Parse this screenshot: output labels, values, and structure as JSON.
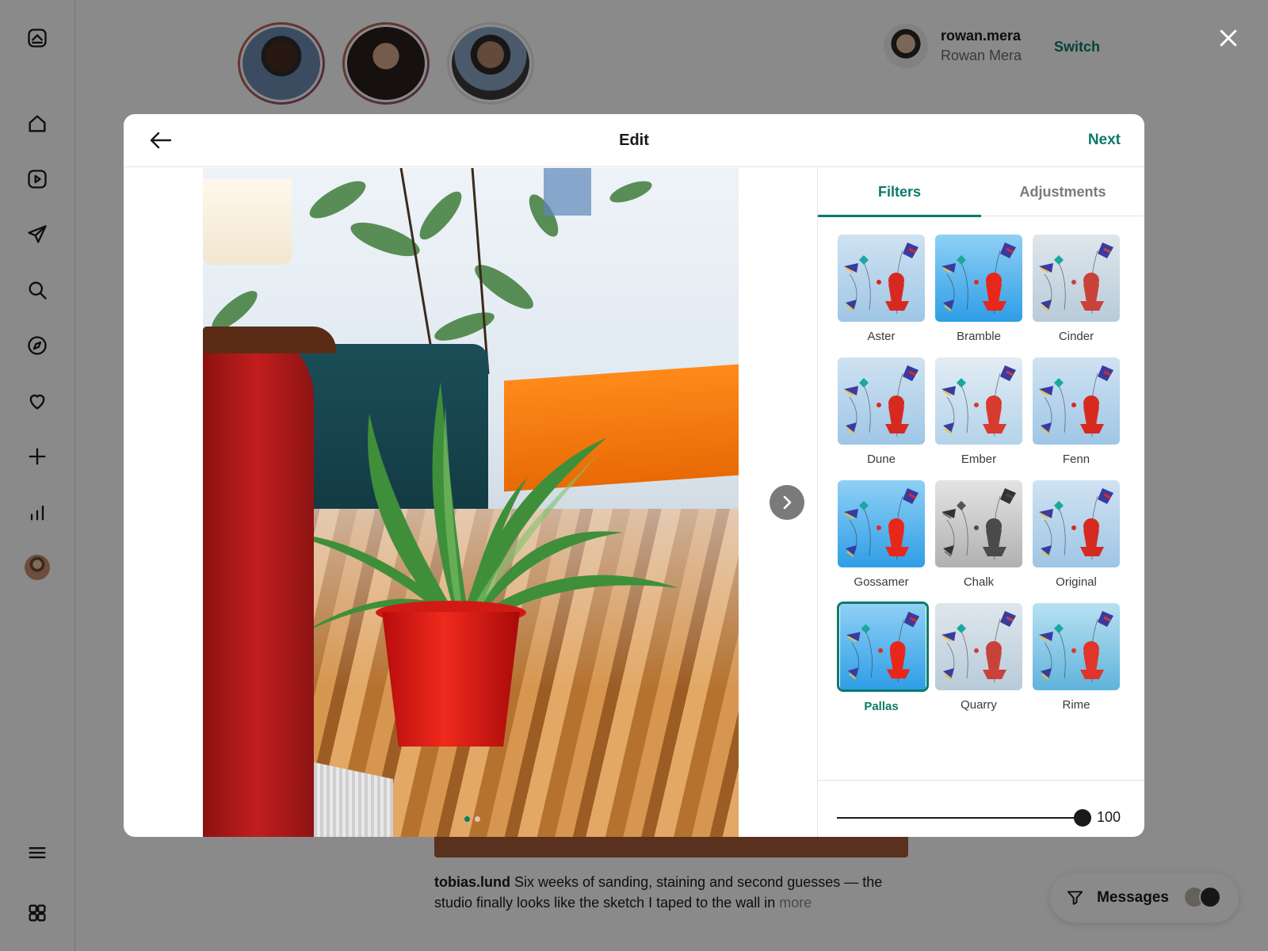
{
  "account": {
    "username": "rowan.mera",
    "name": "Rowan Mera",
    "switch_label": "Switch"
  },
  "caption": {
    "author": "tobias.lund",
    "text": "Six weeks of sanding, staining and second guesses — the studio finally looks like the sketch I taped to the wall in",
    "more_label": "more"
  },
  "messages": {
    "label": "Messages"
  },
  "modal": {
    "title": "Edit",
    "next_label": "Next"
  },
  "tabs": {
    "filters": "Filters",
    "adjustments": "Adjustments"
  },
  "filters": [
    {
      "name": "Aster",
      "tone": "soft"
    },
    {
      "name": "Bramble",
      "tone": "vivid"
    },
    {
      "name": "Cinder",
      "tone": "faded"
    },
    {
      "name": "Dune",
      "tone": "soft"
    },
    {
      "name": "Ember",
      "tone": "pale"
    },
    {
      "name": "Fenn",
      "tone": "soft"
    },
    {
      "name": "Gossamer",
      "tone": "vivid"
    },
    {
      "name": "Chalk",
      "tone": "mono"
    },
    {
      "name": "Original",
      "tone": "soft"
    },
    {
      "name": "Pallas",
      "tone": "vivid",
      "selected": true
    },
    {
      "name": "Quarry",
      "tone": "faded"
    },
    {
      "name": "Rime",
      "tone": "cool"
    }
  ],
  "selected_filter": "Pallas",
  "intensity": {
    "value": 100,
    "display": "100",
    "min": 0,
    "max": 100
  },
  "photo": {
    "slides": 2,
    "current_slide": 1
  },
  "colors": {
    "accent": "#0b7a6c",
    "overlay": "rgba(0,0,0,0.46)"
  }
}
